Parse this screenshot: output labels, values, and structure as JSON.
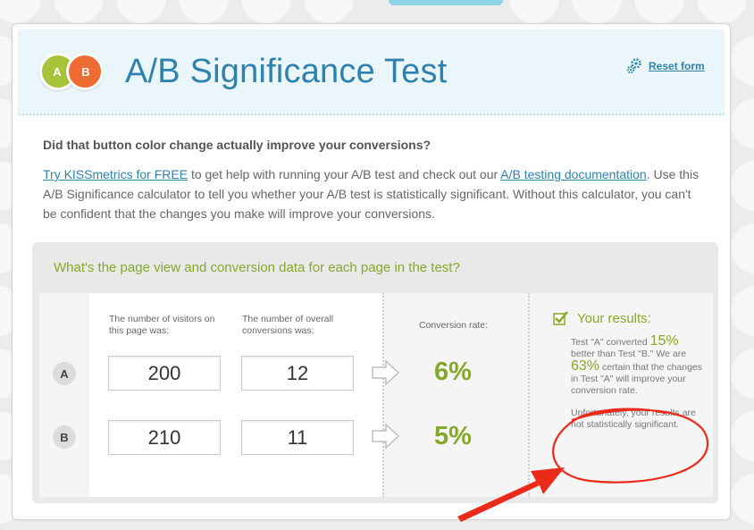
{
  "header": {
    "logo_a": "A",
    "logo_b": "B",
    "title": "A/B Significance Test",
    "reset_label": "Reset form"
  },
  "intro": {
    "question": "Did that button color change actually improve your conversions?",
    "link1": "Try KISSmetrics for FREE",
    "text1": " to get help with running your A/B test and check out our ",
    "link2": "A/B testing documentation",
    "text2": ". Use this A/B Significance calculator to tell you whether your A/B test is statistically significant. Without this calculator, you can't be confident that the changes you make will improve your conversions."
  },
  "panel": {
    "question": "What's the page view and conversion data for each page in the test?",
    "visitors_label": "The number of visitors on this page was:",
    "conversions_label": "The number of overall conversions was:",
    "rate_label": "Conversion rate:",
    "rows": [
      {
        "label": "A",
        "visitors": "200",
        "conversions": "12",
        "rate": "6%"
      },
      {
        "label": "B",
        "visitors": "210",
        "conversions": "11",
        "rate": "5%"
      }
    ]
  },
  "results": {
    "title": "Your results:",
    "t1": "Test \"A\" converted ",
    "pct1": "15%",
    "t2": " better than Test \"B.\" We are ",
    "pct2": "63%",
    "t3": " certain that the changes in Test \"A\" will improve your conversion rate.",
    "note": "Unfortunately, your results are not statistically significant."
  },
  "colors": {
    "accent_blue": "#2f82ad",
    "accent_green": "#86a82a",
    "logo_a": "#a7c33a",
    "logo_b": "#ee6b34",
    "annotation_red": "#ea2a1a"
  }
}
